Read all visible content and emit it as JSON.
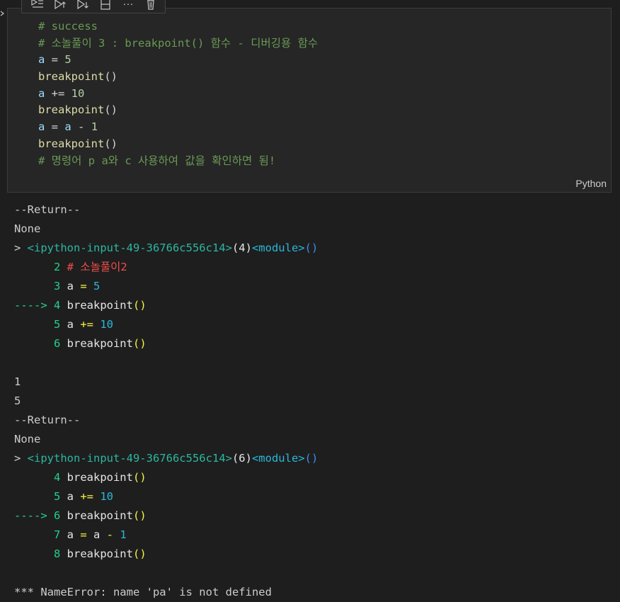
{
  "colors": {
    "background": "#1e1e1e",
    "cell_background": "#262626",
    "comment": "#6a9955",
    "variable": "#9cdcfe",
    "number": "#b5cea8",
    "function": "#dcdcaa",
    "ansi_green": "#23d18b",
    "ansi_blue": "#3b8eea",
    "ansi_cyan": "#29b8db",
    "ansi_yellow": "#f5f543",
    "ansi_red": "#f14c4c"
  },
  "toolbar": {
    "icons": [
      "run-by-line-icon",
      "execute-above-icon",
      "execute-below-icon",
      "split-cell-icon",
      "more-actions-icon",
      "delete-cell-icon"
    ],
    "more_glyph": "···"
  },
  "cell": {
    "language": "Python",
    "lines": [
      [
        {
          "t": "# success",
          "c": "comment"
        }
      ],
      [
        {
          "t": "# 소놀풀이 3 : breakpoint() 함수 - 디버깅용 함수",
          "c": "comment"
        }
      ],
      [
        {
          "t": "a",
          "c": "var"
        },
        {
          "t": " = ",
          "c": "op"
        },
        {
          "t": "5",
          "c": "num"
        }
      ],
      [
        {
          "t": "breakpoint",
          "c": "fn"
        },
        {
          "t": "()",
          "c": "paren"
        }
      ],
      [
        {
          "t": "a",
          "c": "var"
        },
        {
          "t": " += ",
          "c": "op"
        },
        {
          "t": "10",
          "c": "num"
        }
      ],
      [
        {
          "t": "breakpoint",
          "c": "fn"
        },
        {
          "t": "()",
          "c": "paren"
        }
      ],
      [
        {
          "t": "a",
          "c": "var"
        },
        {
          "t": " = ",
          "c": "op"
        },
        {
          "t": "a",
          "c": "var"
        },
        {
          "t": " - ",
          "c": "op"
        },
        {
          "t": "1",
          "c": "num"
        }
      ],
      [
        {
          "t": "breakpoint",
          "c": "fn"
        },
        {
          "t": "()",
          "c": "paren"
        }
      ],
      [
        {
          "t": "# 명령어 p a와 c 사용하여 값을 확인하면 됨!",
          "c": "comment"
        }
      ]
    ]
  },
  "output": {
    "lines": [
      [
        {
          "t": "--Return--",
          "c": "plain"
        }
      ],
      [
        {
          "t": "None",
          "c": "plain"
        }
      ],
      [
        {
          "t": "> ",
          "c": "plain"
        },
        {
          "t": "<ipython-input-49-36766c556c14>",
          "c": "teal"
        },
        {
          "t": "(4)",
          "c": "white"
        },
        {
          "t": "<module>",
          "c": "cyan"
        },
        {
          "t": "()",
          "c": "blue"
        }
      ],
      [
        {
          "t": "      2 ",
          "c": "green"
        },
        {
          "t": "# 소놀풀이2",
          "c": "red"
        }
      ],
      [
        {
          "t": "      3 ",
          "c": "green"
        },
        {
          "t": "a ",
          "c": "white"
        },
        {
          "t": "=",
          "c": "yellow"
        },
        {
          "t": " ",
          "c": "white"
        },
        {
          "t": "5",
          "c": "cyan"
        }
      ],
      [
        {
          "t": "----> 4 ",
          "c": "green"
        },
        {
          "t": "breakpoint",
          "c": "white"
        },
        {
          "t": "()",
          "c": "yellow"
        }
      ],
      [
        {
          "t": "      5 ",
          "c": "green"
        },
        {
          "t": "a ",
          "c": "white"
        },
        {
          "t": "+=",
          "c": "yellow"
        },
        {
          "t": " ",
          "c": "white"
        },
        {
          "t": "10",
          "c": "cyan"
        }
      ],
      [
        {
          "t": "      6 ",
          "c": "green"
        },
        {
          "t": "breakpoint",
          "c": "white"
        },
        {
          "t": "()",
          "c": "yellow"
        }
      ],
      [
        {
          "t": "",
          "c": "plain"
        }
      ],
      [
        {
          "t": "1",
          "c": "plain"
        }
      ],
      [
        {
          "t": "5",
          "c": "plain"
        }
      ],
      [
        {
          "t": "--Return--",
          "c": "plain"
        }
      ],
      [
        {
          "t": "None",
          "c": "plain"
        }
      ],
      [
        {
          "t": "> ",
          "c": "plain"
        },
        {
          "t": "<ipython-input-49-36766c556c14>",
          "c": "teal"
        },
        {
          "t": "(6)",
          "c": "white"
        },
        {
          "t": "<module>",
          "c": "cyan"
        },
        {
          "t": "()",
          "c": "blue"
        }
      ],
      [
        {
          "t": "      4 ",
          "c": "green"
        },
        {
          "t": "breakpoint",
          "c": "white"
        },
        {
          "t": "()",
          "c": "yellow"
        }
      ],
      [
        {
          "t": "      5 ",
          "c": "green"
        },
        {
          "t": "a ",
          "c": "white"
        },
        {
          "t": "+=",
          "c": "yellow"
        },
        {
          "t": " ",
          "c": "white"
        },
        {
          "t": "10",
          "c": "cyan"
        }
      ],
      [
        {
          "t": "----> 6 ",
          "c": "green"
        },
        {
          "t": "breakpoint",
          "c": "white"
        },
        {
          "t": "()",
          "c": "yellow"
        }
      ],
      [
        {
          "t": "      7 ",
          "c": "green"
        },
        {
          "t": "a ",
          "c": "white"
        },
        {
          "t": "=",
          "c": "yellow"
        },
        {
          "t": " a ",
          "c": "white"
        },
        {
          "t": "-",
          "c": "yellow"
        },
        {
          "t": " ",
          "c": "white"
        },
        {
          "t": "1",
          "c": "cyan"
        }
      ],
      [
        {
          "t": "      8 ",
          "c": "green"
        },
        {
          "t": "breakpoint",
          "c": "white"
        },
        {
          "t": "()",
          "c": "yellow"
        }
      ],
      [
        {
          "t": "",
          "c": "plain"
        }
      ],
      [
        {
          "t": "*** NameError: name 'pa' is not defined",
          "c": "plain"
        }
      ]
    ]
  }
}
